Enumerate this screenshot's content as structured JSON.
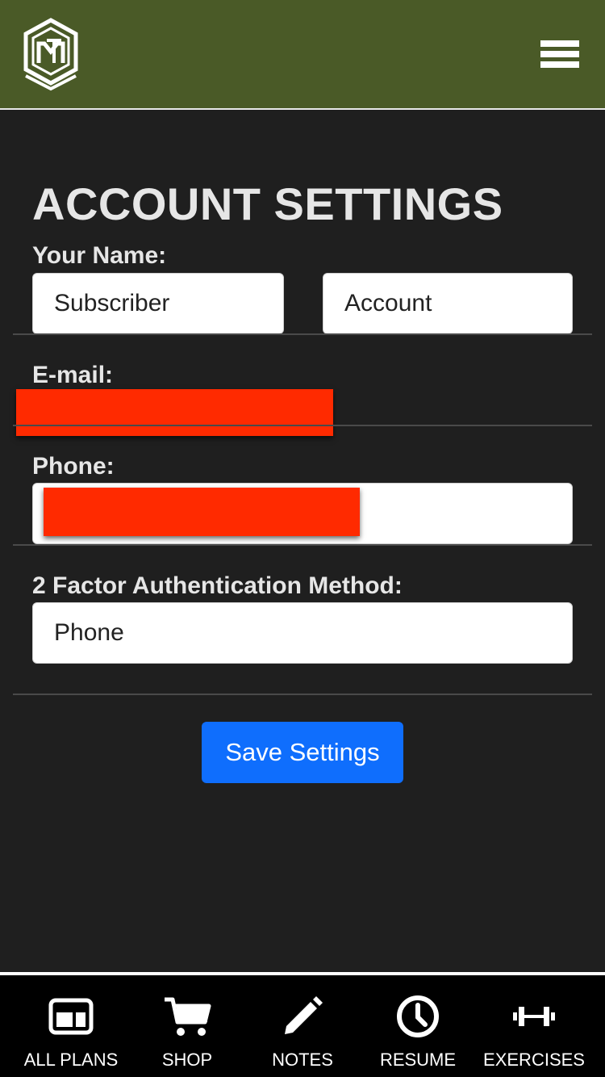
{
  "header": {
    "logo_icon": "mt-logo-icon",
    "menu_icon": "hamburger-menu-icon"
  },
  "page": {
    "title": "ACCOUNT SETTINGS"
  },
  "form": {
    "name_label": "Your Name:",
    "first_name": "Subscriber",
    "last_name": "Account",
    "email_label": "E-mail:",
    "phone_label": "Phone:",
    "twofa_label": "2 Factor Authentication Method:",
    "twofa_value": "Phone",
    "save_label": "Save Settings"
  },
  "colors": {
    "header_bg": "#4a5a27",
    "page_bg": "#1f1f1f",
    "save_button": "#0f6efd",
    "redaction": "#ff2a00"
  },
  "tabbar": {
    "items": [
      {
        "label": "ALL PLANS",
        "icon": "plans-icon"
      },
      {
        "label": "SHOP",
        "icon": "cart-icon"
      },
      {
        "label": "NOTES",
        "icon": "pencil-icon"
      },
      {
        "label": "RESUME",
        "icon": "clock-icon"
      },
      {
        "label": "EXERCISES",
        "icon": "dumbbell-icon"
      }
    ]
  }
}
